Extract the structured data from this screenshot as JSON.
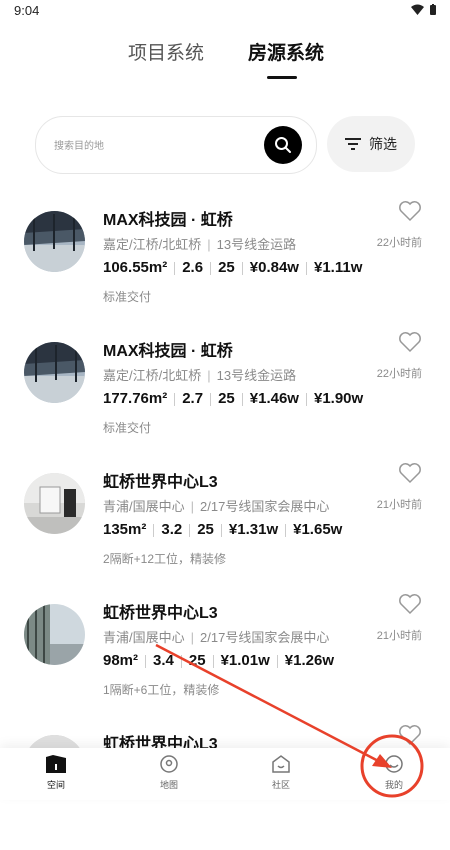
{
  "status": {
    "time": "9:04"
  },
  "tabs": [
    {
      "label": "项目系统"
    },
    {
      "label": "房源系统"
    }
  ],
  "search": {
    "placeholder": "搜索目的地",
    "filter_label": "筛选"
  },
  "listings": [
    {
      "title": "MAX科技园 · 虹桥",
      "loc": "嘉定/江桥/北虹桥",
      "line": "13号线金运路",
      "time": "22小时前",
      "area": "106.55m²",
      "ratio": "2.6",
      "floor": "25",
      "price1": "¥0.84w",
      "price2": "¥1.11w",
      "note": "标准交付"
    },
    {
      "title": "MAX科技园 · 虹桥",
      "loc": "嘉定/江桥/北虹桥",
      "line": "13号线金运路",
      "time": "22小时前",
      "area": "177.76m²",
      "ratio": "2.7",
      "floor": "25",
      "price1": "¥1.46w",
      "price2": "¥1.90w",
      "note": "标准交付"
    },
    {
      "title": "虹桥世界中心L3",
      "loc": "青浦/国展中心",
      "line": "2/17号线国家会展中心",
      "time": "21小时前",
      "area": "135m²",
      "ratio": "3.2",
      "floor": "25",
      "price1": "¥1.31w",
      "price2": "¥1.65w",
      "note": "2隔断+12工位，精装修"
    },
    {
      "title": "虹桥世界中心L3",
      "loc": "青浦/国展中心",
      "line": "2/17号线国家会展中心",
      "time": "21小时前",
      "area": "98m²",
      "ratio": "3.4",
      "floor": "25",
      "price1": "¥1.01w",
      "price2": "¥1.26w",
      "note": "1隔断+6工位，精装修"
    },
    {
      "title": "虹桥世界中心L3"
    }
  ],
  "bottom_nav": [
    {
      "label": "空间"
    },
    {
      "label": "地图"
    },
    {
      "label": "社区"
    },
    {
      "label": "我的"
    }
  ],
  "colors": {
    "accent": "#000000",
    "annotation": "#e8412b"
  }
}
